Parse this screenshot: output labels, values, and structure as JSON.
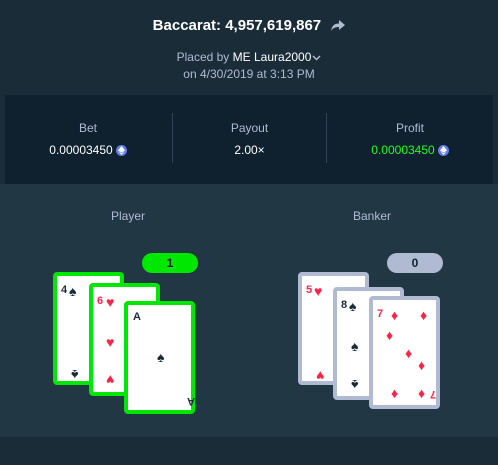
{
  "header": {
    "title": "Baccarat: 4,957,619,867",
    "placed_by_prefix": "Placed by",
    "badge": "ME",
    "username": "Laura2000",
    "date_line": "on 4/30/2019 at 3:13 PM"
  },
  "stats": {
    "bet_label": "Bet",
    "bet_value": "0.00003450",
    "payout_label": "Payout",
    "payout_value": "2.00×",
    "profit_label": "Profit",
    "profit_value": "0.00003450",
    "currency_icon": "ethereum-icon",
    "profit_color": "#1fff20"
  },
  "player": {
    "label": "Player",
    "score": "1",
    "result": "win",
    "cards": [
      {
        "rank": "4",
        "suit": "♠",
        "color": "black"
      },
      {
        "rank": "6",
        "suit": "♥",
        "color": "red"
      },
      {
        "rank": "A",
        "suit": "♠",
        "color": "black"
      }
    ]
  },
  "banker": {
    "label": "Banker",
    "score": "0",
    "result": "lose",
    "cards": [
      {
        "rank": "5",
        "suit": "♥",
        "color": "red"
      },
      {
        "rank": "8",
        "suit": "♠",
        "color": "black"
      },
      {
        "rank": "7",
        "suit": "♦",
        "color": "red"
      }
    ]
  },
  "colors": {
    "background": "#1a2c38",
    "panel": "#0f212e",
    "table": "#213743",
    "win": "#00e701",
    "lose": "#b1bad3",
    "red_suit": "#fe2247"
  }
}
